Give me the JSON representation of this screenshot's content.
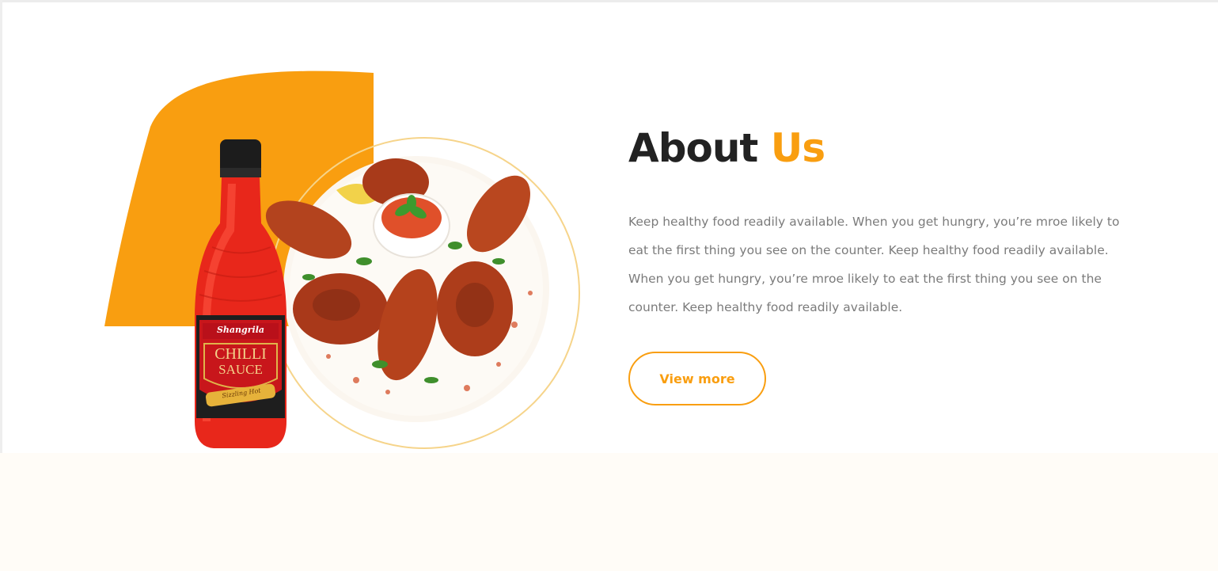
{
  "about": {
    "title_main": "About",
    "title_accent": "Us",
    "body": "Keep healthy food readily available. When you get hungry, you’re mroe likely to eat the first thing you see on the counter.  Keep healthy food readily available. When you get hungry, you’re mroe likely to eat the first thing you see on the counter.  Keep healthy food readily available.",
    "button_label": "View more"
  },
  "product": {
    "brand": "Shangrila",
    "name_line1": "CHILLI",
    "name_line2": "SAUCE",
    "tagline": "Sizzling Hot"
  },
  "colors": {
    "accent": "#f99e10",
    "heading": "#222222",
    "body_text": "#7b7b7b",
    "bottom_band": "#fffcf7"
  },
  "images": {
    "decor": "orange-leaf-shape",
    "plate": "grilled-chicken-plate",
    "bottle": "chilli-sauce-bottle"
  }
}
